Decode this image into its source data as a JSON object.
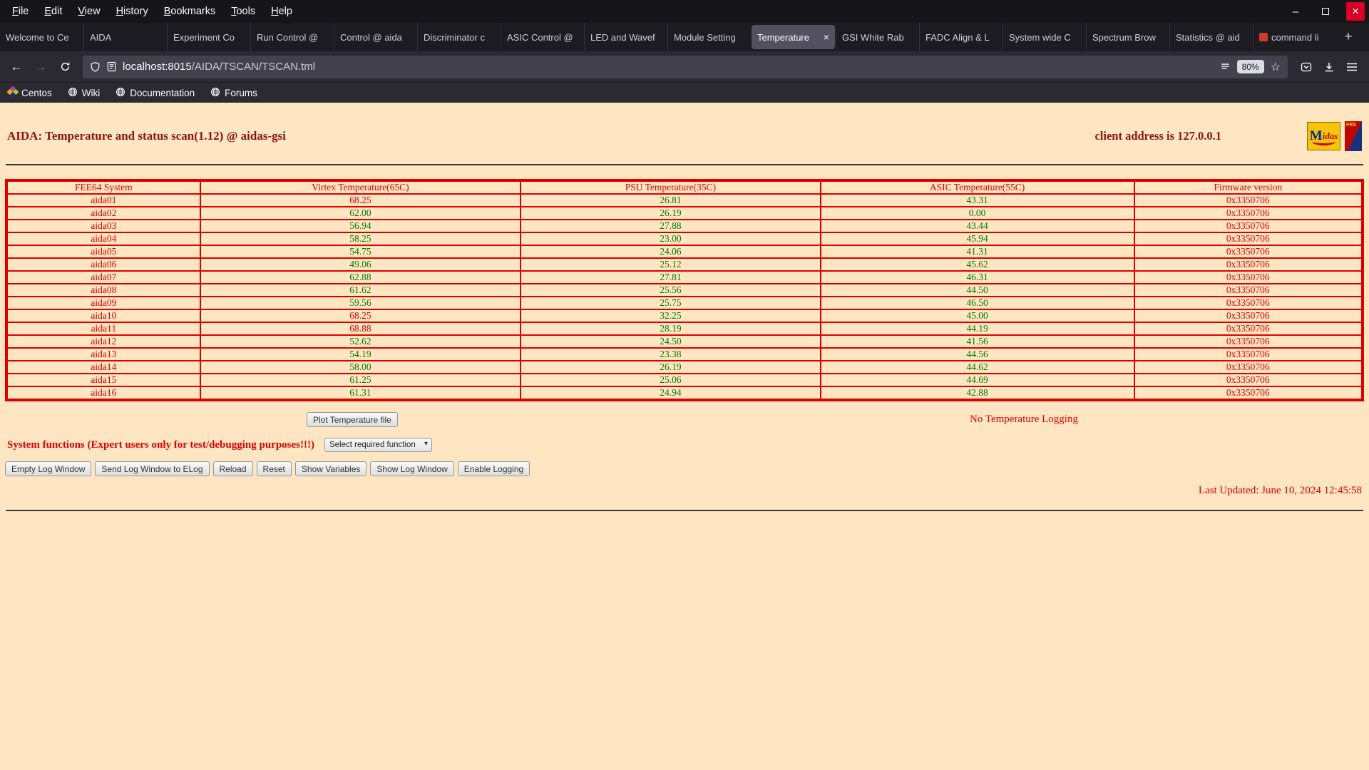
{
  "browser": {
    "menu": [
      "File",
      "Edit",
      "View",
      "History",
      "Bookmarks",
      "Tools",
      "Help"
    ],
    "tabs": [
      {
        "label": "Welcome to Ce",
        "active": false
      },
      {
        "label": "AIDA",
        "active": false
      },
      {
        "label": "Experiment Co",
        "active": false
      },
      {
        "label": "Run Control @",
        "active": false
      },
      {
        "label": "Control @ aida",
        "active": false
      },
      {
        "label": "Discriminator c",
        "active": false
      },
      {
        "label": "ASIC Control @",
        "active": false
      },
      {
        "label": "LED and Wavef",
        "active": false
      },
      {
        "label": "Module Setting",
        "active": false
      },
      {
        "label": "Temperature",
        "active": true
      },
      {
        "label": "GSI White Rab",
        "active": false
      },
      {
        "label": "FADC Align & L",
        "active": false
      },
      {
        "label": "System wide C",
        "active": false
      },
      {
        "label": "Spectrum Brow",
        "active": false
      },
      {
        "label": "Statistics @ aid",
        "active": false
      },
      {
        "label": "command li",
        "active": false,
        "icon": "terminal"
      }
    ],
    "new_tab_label": "+",
    "url": {
      "host": "localhost:8015",
      "path": "/AIDA/TSCAN/TSCAN.tml"
    },
    "zoom": "80%",
    "bookmarks": [
      {
        "label": "Centos",
        "icon": "centos"
      },
      {
        "label": "Wiki",
        "icon": "globe"
      },
      {
        "label": "Documentation",
        "icon": "globe"
      },
      {
        "label": "Forums",
        "icon": "globe"
      }
    ]
  },
  "page": {
    "title": "AIDA: Temperature and status scan(1.12) @ aidas-gsi",
    "client_address": "client address is 127.0.0.1",
    "table": {
      "headers": [
        "FEE64 System",
        "Virtex Temperature(65C)",
        "PSU Temperature(35C)",
        "ASIC Temperature(55C)",
        "Firmware version"
      ],
      "rows": [
        {
          "name": "aida01",
          "virtex": "68.25",
          "virtex_alarm": true,
          "psu": "26.81",
          "asic": "43.31",
          "fw": "0x3350706"
        },
        {
          "name": "aida02",
          "virtex": "62.00",
          "virtex_alarm": false,
          "psu": "26.19",
          "asic": "0.00",
          "fw": "0x3350706"
        },
        {
          "name": "aida03",
          "virtex": "56.94",
          "virtex_alarm": false,
          "psu": "27.88",
          "asic": "43.44",
          "fw": "0x3350706"
        },
        {
          "name": "aida04",
          "virtex": "58.25",
          "virtex_alarm": false,
          "psu": "23.00",
          "asic": "45.94",
          "fw": "0x3350706"
        },
        {
          "name": "aida05",
          "virtex": "54.75",
          "virtex_alarm": false,
          "psu": "24.06",
          "asic": "41.31",
          "fw": "0x3350706"
        },
        {
          "name": "aida06",
          "virtex": "49.06",
          "virtex_alarm": false,
          "psu": "25.12",
          "asic": "45.62",
          "fw": "0x3350706"
        },
        {
          "name": "aida07",
          "virtex": "62.88",
          "virtex_alarm": false,
          "psu": "27.81",
          "asic": "46.31",
          "fw": "0x3350706"
        },
        {
          "name": "aida08",
          "virtex": "61.62",
          "virtex_alarm": false,
          "psu": "25.56",
          "asic": "44.50",
          "fw": "0x3350706"
        },
        {
          "name": "aida09",
          "virtex": "59.56",
          "virtex_alarm": false,
          "psu": "25.75",
          "asic": "46.50",
          "fw": "0x3350706"
        },
        {
          "name": "aida10",
          "virtex": "68.25",
          "virtex_alarm": true,
          "psu": "32.25",
          "asic": "45.00",
          "fw": "0x3350706"
        },
        {
          "name": "aida11",
          "virtex": "68.88",
          "virtex_alarm": true,
          "psu": "28.19",
          "asic": "44.19",
          "fw": "0x3350706"
        },
        {
          "name": "aida12",
          "virtex": "52.62",
          "virtex_alarm": false,
          "psu": "24.50",
          "asic": "41.56",
          "fw": "0x3350706"
        },
        {
          "name": "aida13",
          "virtex": "54.19",
          "virtex_alarm": false,
          "psu": "23.38",
          "asic": "44.56",
          "fw": "0x3350706"
        },
        {
          "name": "aida14",
          "virtex": "58.00",
          "virtex_alarm": false,
          "psu": "26.19",
          "asic": "44.62",
          "fw": "0x3350706"
        },
        {
          "name": "aida15",
          "virtex": "61.25",
          "virtex_alarm": false,
          "psu": "25.06",
          "asic": "44.69",
          "fw": "0x3350706"
        },
        {
          "name": "aida16",
          "virtex": "61.31",
          "virtex_alarm": false,
          "psu": "24.94",
          "asic": "42.88",
          "fw": "0x3350706"
        }
      ]
    },
    "plot_button": "Plot Temperature file",
    "logging_status": "No Temperature Logging",
    "system_functions_label": "System functions (Expert users only for test/debugging purposes!!!)",
    "function_select": "Select required function",
    "action_buttons": [
      "Empty Log Window",
      "Send Log Window to ELog",
      "Reload",
      "Reset",
      "Show Variables",
      "Show Log Window",
      "Enable Logging"
    ],
    "last_updated": "Last Updated: June 10, 2024 12:45:58"
  },
  "colors": {
    "page_bg": "#FEE6C3",
    "maroon": "#8B1414",
    "red": "#DE0000",
    "green": "#007A00"
  }
}
